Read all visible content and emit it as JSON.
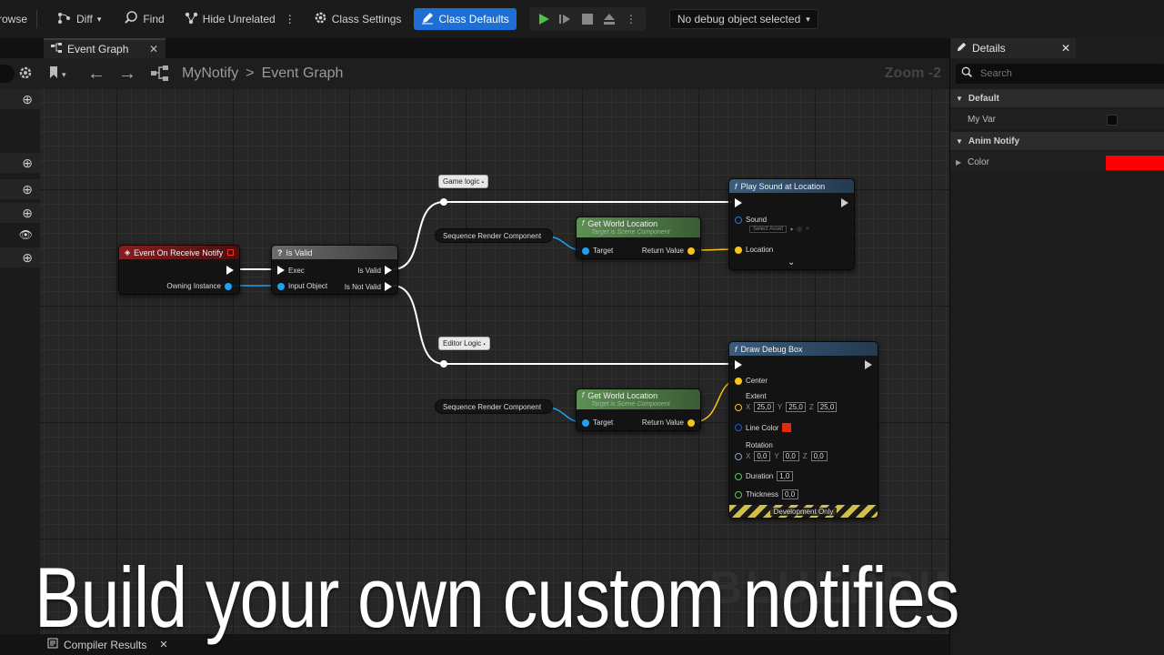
{
  "toolbar": {
    "browse": "rowse",
    "diff": "Diff",
    "find": "Find",
    "hide_unrelated": "Hide Unrelated",
    "class_settings": "Class Settings",
    "class_defaults": "Class Defaults",
    "debug_object": "No debug object selected"
  },
  "tabs": {
    "event_graph": "Event Graph"
  },
  "breadcrumb": {
    "root": "MyNotify",
    "separator": ">",
    "current": "Event Graph",
    "zoom": "Zoom -2"
  },
  "nodes": {
    "event": {
      "title": "Event On Receive Notify",
      "pin_owning": "Owning Instance"
    },
    "is_valid": {
      "title": "Is Valid",
      "glyph": "?",
      "exec": "Exec",
      "is_valid": "Is Valid",
      "input": "Input Object",
      "not_valid": "Is Not Valid"
    },
    "comment_game": "Game logic",
    "comment_editor": "Editor Logic",
    "seq1": "Sequence Render Component",
    "seq2": "Sequence Render Component",
    "gwl1": {
      "title": "Get World Location",
      "sub": "Target is Scene Component",
      "target": "Target",
      "ret": "Return Value"
    },
    "gwl2": {
      "title": "Get World Location",
      "sub": "Target is Scene Component",
      "target": "Target",
      "ret": "Return Value"
    },
    "play_sound": {
      "title": "Play Sound at Location",
      "sound": "Sound",
      "select": "Select Asset",
      "location": "Location"
    },
    "draw_box": {
      "title": "Draw Debug Box",
      "center": "Center",
      "extent": "Extent",
      "ex": "25,0",
      "ey": "25,0",
      "ez": "25,0",
      "line_color": "Line Color",
      "rotation": "Rotation",
      "rx": "0,0",
      "ry": "0,0",
      "rz": "0,0",
      "duration": "Duration",
      "duration_val": "1,0",
      "thickness": "Thickness",
      "thickness_val": "0,0",
      "dev_only": "Development Only"
    }
  },
  "axes": {
    "x": "X",
    "y": "Y",
    "z": "Z"
  },
  "details": {
    "tab": "Details",
    "search_placeholder": "Search",
    "cat_default": "Default",
    "my_var": "My Var",
    "cat_anim": "Anim Notify",
    "color": "Color",
    "color_value": "#ff0000"
  },
  "bottom": {
    "compiler": "Compiler Results"
  },
  "watermark": "BLUEPRINT",
  "caption": "Build your own custom notifies"
}
